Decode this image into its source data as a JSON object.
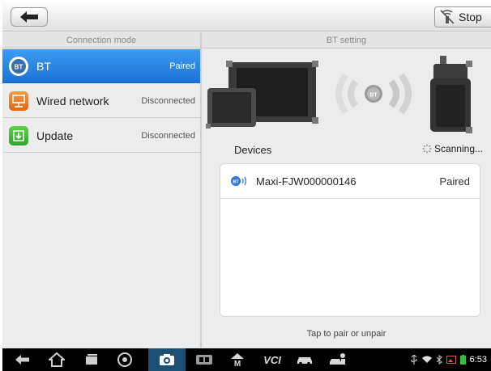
{
  "toolbar": {
    "stop_label": "Stop"
  },
  "left": {
    "header": "Connection mode",
    "items": [
      {
        "label": "BT",
        "status": "Paired",
        "icon": "bluetooth-icon",
        "selected": true
      },
      {
        "label": "Wired network",
        "status": "Disconnected",
        "icon": "network-icon",
        "selected": false
      },
      {
        "label": "Update",
        "status": "Disconnected",
        "icon": "update-icon",
        "selected": false
      }
    ]
  },
  "right": {
    "header": "BT setting",
    "devices_label": "Devices",
    "scanning_label": "Scanning...",
    "devices": [
      {
        "name": "Maxi-FJW000000146",
        "status": "Paired"
      }
    ],
    "hint": "Tap to pair or unpair"
  },
  "navbar": {
    "vcl_label": "VCI",
    "time": "6:53"
  },
  "colors": {
    "accent": "#1a73d8",
    "navbar": "#000000",
    "nav_active": "#1c4f74"
  }
}
